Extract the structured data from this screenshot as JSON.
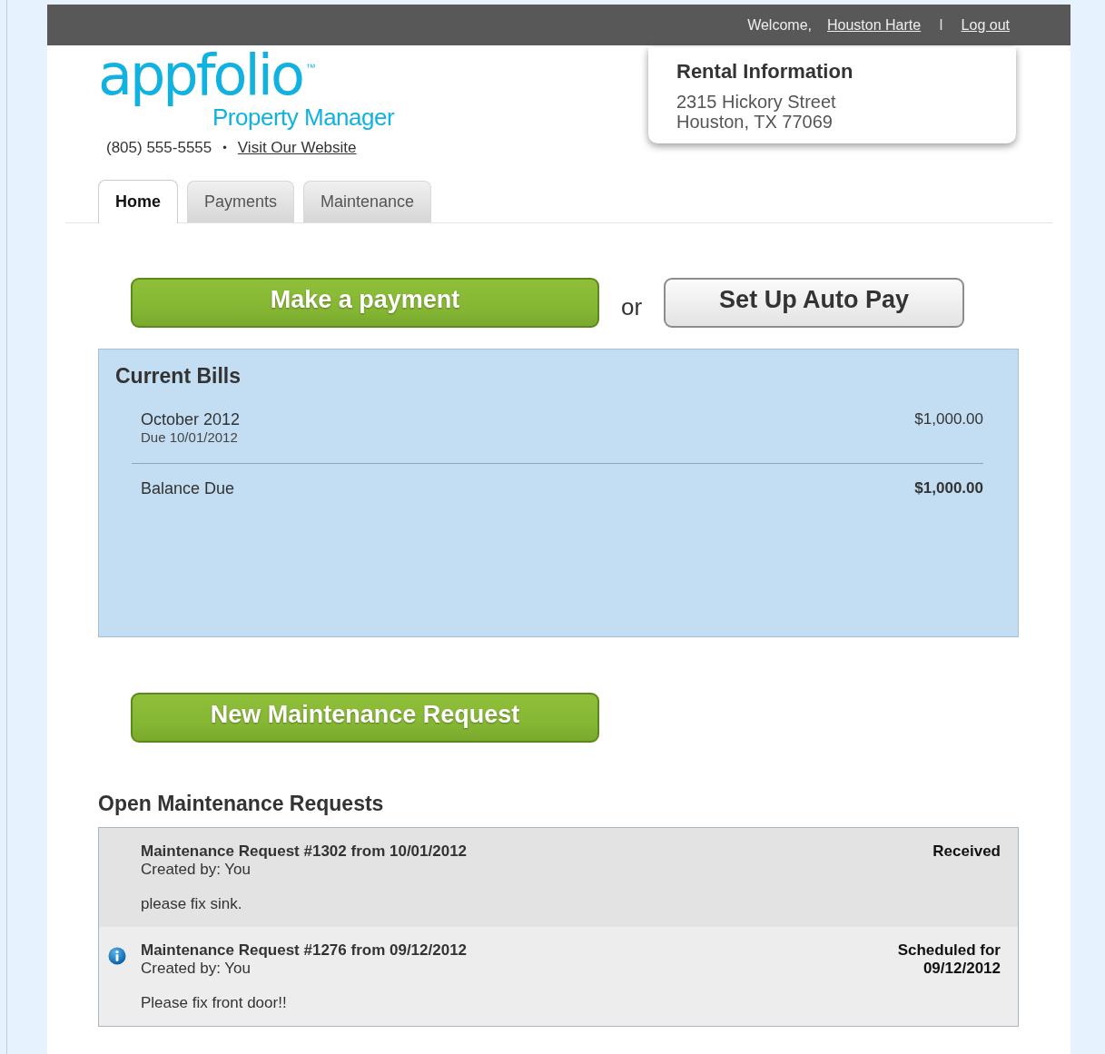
{
  "top_bar": {
    "welcome": "Welcome,",
    "user_link": "Houston Harte",
    "separator": "I",
    "logout": "Log out"
  },
  "logo": {
    "name": "appfolio",
    "tm": "™",
    "subtitle": "Property Manager"
  },
  "contact": {
    "phone": "(805) 555-5555",
    "bullet": "•",
    "website": "Visit Our Website"
  },
  "rental_info": {
    "title": "Rental Information",
    "lines": [
      "2315 Hickory Street",
      "Houston, TX 77069"
    ]
  },
  "tabs": [
    {
      "label": "Home",
      "selected": true
    },
    {
      "label": "Payments",
      "selected": false
    },
    {
      "label": "Maintenance",
      "selected": false
    }
  ],
  "payment_actions": {
    "primary": "Make a payment",
    "or": "or",
    "secondary": "Set Up Auto Pay"
  },
  "current_bills": {
    "title": "Current Bills",
    "items": [
      {
        "label": "October 2012",
        "due": "Due 10/01/2012",
        "amount": "$1,000.00"
      }
    ],
    "balance": {
      "label": "Balance Due",
      "amount": "$1,000.00"
    }
  },
  "new_request_button": "New Maintenance Request",
  "open_requests": {
    "title": "Open Maintenance Requests",
    "rows": [
      {
        "title": "Maintenance Request #1302 from 10/01/2012",
        "created": "Created by: You",
        "note": "please fix sink.",
        "status": [
          "Received"
        ],
        "info": false
      },
      {
        "title": "Maintenance Request #1276 from 09/12/2012",
        "created": "Created by: You",
        "note": "Please fix front door!!",
        "status": [
          "Scheduled for",
          "09/12/2012"
        ],
        "info": true
      }
    ]
  }
}
